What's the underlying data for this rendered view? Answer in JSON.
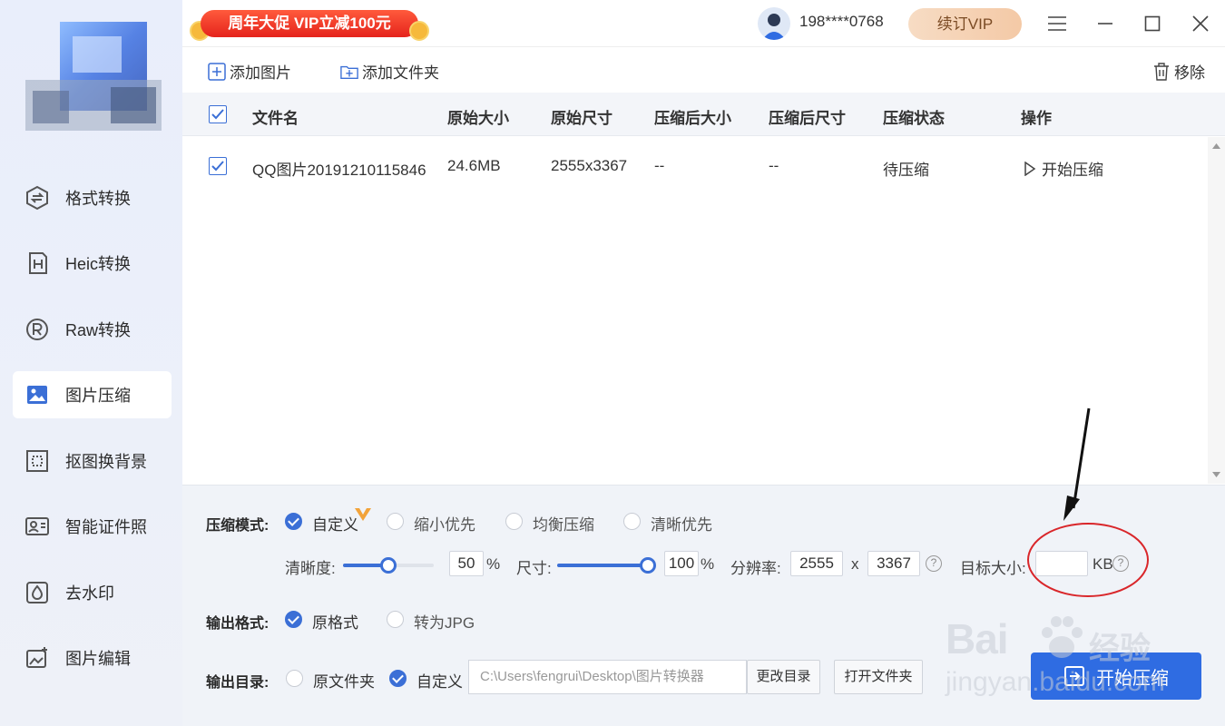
{
  "promo": {
    "text": "周年大促 VIP立减100元"
  },
  "user": {
    "phone": "198****0768",
    "renew_label": "续订VIP"
  },
  "sidebar": {
    "items": [
      {
        "label": "格式转换",
        "icon": "format-convert-icon",
        "active": false
      },
      {
        "label": "Heic转换",
        "icon": "heic-icon",
        "active": false
      },
      {
        "label": "Raw转换",
        "icon": "raw-icon",
        "active": false
      },
      {
        "label": "图片压缩",
        "icon": "image-compress-icon",
        "active": true
      },
      {
        "label": "抠图换背景",
        "icon": "cutout-icon",
        "active": false
      },
      {
        "label": "智能证件照",
        "icon": "id-photo-icon",
        "active": false
      },
      {
        "label": "去水印",
        "icon": "watermark-remove-icon",
        "active": false
      },
      {
        "label": "图片编辑",
        "icon": "image-edit-icon",
        "active": false
      }
    ]
  },
  "toolbar": {
    "add_image": "添加图片",
    "add_folder": "添加文件夹",
    "remove": "移除"
  },
  "table": {
    "columns": [
      "文件名",
      "原始大小",
      "原始尺寸",
      "压缩后大小",
      "压缩后尺寸",
      "压缩状态",
      "操作"
    ],
    "rows": [
      {
        "checked": true,
        "name": "QQ图片20191210115846",
        "size": "24.6MB",
        "dims": "2555x3367",
        "new_size": "--",
        "new_dims": "--",
        "status": "待压缩",
        "action": "开始压缩"
      }
    ]
  },
  "settings": {
    "mode_label": "压缩模式:",
    "modes": [
      {
        "label": "自定义",
        "selected": true
      },
      {
        "label": "缩小优先",
        "selected": false
      },
      {
        "label": "均衡压缩",
        "selected": false
      },
      {
        "label": "清晰优先",
        "selected": false
      }
    ],
    "clarity_label": "清晰度:",
    "clarity_value": "50",
    "clarity_fraction": 0.5,
    "percent": "%",
    "size_label": "尺寸:",
    "size_value": "100",
    "size_fraction": 1.0,
    "resolution_label": "分辨率:",
    "res_w": "2555",
    "res_x": "x",
    "res_h": "3367",
    "target_label": "目标大小:",
    "target_value": "",
    "target_unit": "KB",
    "format_label": "输出格式:",
    "formats": [
      {
        "label": "原格式",
        "selected": true
      },
      {
        "label": "转为JPG",
        "selected": false
      }
    ],
    "dir_label": "输出目录:",
    "dirs": [
      {
        "label": "原文件夹",
        "selected": false
      },
      {
        "label": "自定义",
        "selected": true
      }
    ],
    "path": "C:\\Users\\fengrui\\Desktop\\图片转换器",
    "change_dir": "更改目录",
    "open_folder": "打开文件夹",
    "start": "开始压缩"
  },
  "watermark": {
    "brand": "Bai",
    "brand2": "经验",
    "sub": "jingyan.baidu.com"
  },
  "colors": {
    "accent": "#2f6ce2",
    "promo": "#e5241c",
    "annotation": "#d9262a"
  }
}
